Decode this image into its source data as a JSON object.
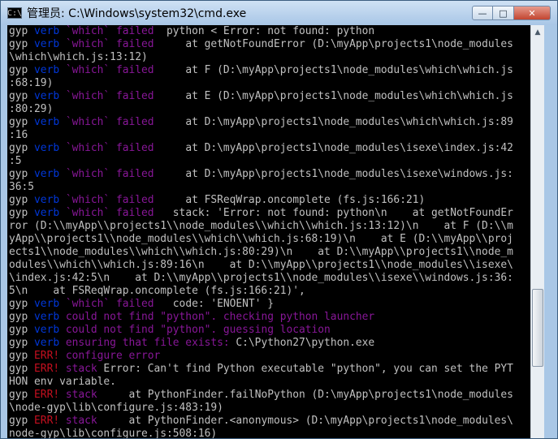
{
  "window": {
    "title": "管理员: C:\\Windows\\system32\\cmd.exe",
    "icon_glyph": "C:\\",
    "controls": {
      "minimize": "—",
      "maximize": "□",
      "close": "✕"
    }
  },
  "colors": {
    "console_bg": "#000000",
    "default": "#c0c0c0",
    "gyp": "#c0c0c0",
    "verb": "#0037da",
    "which_failed": "#881798",
    "err": "#c50f1f",
    "stack": "#881798"
  },
  "console": {
    "lines": [
      [
        {
          "t": "gyp ",
          "c": "gyp"
        },
        {
          "t": "verb",
          "c": "verb"
        },
        {
          "t": " `which` failed",
          "c": "which_failed"
        },
        {
          "t": "  python < Error: not found: python",
          "c": "default"
        }
      ],
      [
        {
          "t": "gyp ",
          "c": "gyp"
        },
        {
          "t": "verb",
          "c": "verb"
        },
        {
          "t": " `which` failed",
          "c": "which_failed"
        },
        {
          "t": "     at getNotFoundError (D:\\myApp\\projects1\\node_modules",
          "c": "default"
        }
      ],
      [
        {
          "t": "\\which\\which.js:13:12)",
          "c": "default"
        }
      ],
      [
        {
          "t": "gyp ",
          "c": "gyp"
        },
        {
          "t": "verb",
          "c": "verb"
        },
        {
          "t": " `which` failed",
          "c": "which_failed"
        },
        {
          "t": "     at F (D:\\myApp\\projects1\\node_modules\\which\\which.js",
          "c": "default"
        }
      ],
      [
        {
          "t": ":68:19)",
          "c": "default"
        }
      ],
      [
        {
          "t": "gyp ",
          "c": "gyp"
        },
        {
          "t": "verb",
          "c": "verb"
        },
        {
          "t": " `which` failed",
          "c": "which_failed"
        },
        {
          "t": "     at E (D:\\myApp\\projects1\\node_modules\\which\\which.js",
          "c": "default"
        }
      ],
      [
        {
          "t": ":80:29)",
          "c": "default"
        }
      ],
      [
        {
          "t": "gyp ",
          "c": "gyp"
        },
        {
          "t": "verb",
          "c": "verb"
        },
        {
          "t": " `which` failed",
          "c": "which_failed"
        },
        {
          "t": "     at D:\\myApp\\projects1\\node_modules\\which\\which.js:89",
          "c": "default"
        }
      ],
      [
        {
          "t": ":16",
          "c": "default"
        }
      ],
      [
        {
          "t": "gyp ",
          "c": "gyp"
        },
        {
          "t": "verb",
          "c": "verb"
        },
        {
          "t": " `which` failed",
          "c": "which_failed"
        },
        {
          "t": "     at D:\\myApp\\projects1\\node_modules\\isexe\\index.js:42",
          "c": "default"
        }
      ],
      [
        {
          "t": ":5",
          "c": "default"
        }
      ],
      [
        {
          "t": "gyp ",
          "c": "gyp"
        },
        {
          "t": "verb",
          "c": "verb"
        },
        {
          "t": " `which` failed",
          "c": "which_failed"
        },
        {
          "t": "     at D:\\myApp\\projects1\\node_modules\\isexe\\windows.js:",
          "c": "default"
        }
      ],
      [
        {
          "t": "36:5",
          "c": "default"
        }
      ],
      [
        {
          "t": "gyp ",
          "c": "gyp"
        },
        {
          "t": "verb",
          "c": "verb"
        },
        {
          "t": " `which` failed",
          "c": "which_failed"
        },
        {
          "t": "     at FSReqWrap.oncomplete (fs.js:166:21)",
          "c": "default"
        }
      ],
      [
        {
          "t": "gyp ",
          "c": "gyp"
        },
        {
          "t": "verb",
          "c": "verb"
        },
        {
          "t": " `which` failed",
          "c": "which_failed"
        },
        {
          "t": "   stack: 'Error: not found: python\\n    at getNotFoundEr",
          "c": "default"
        }
      ],
      [
        {
          "t": "ror (D:\\\\myApp\\\\projects1\\\\node_modules\\\\which\\\\which.js:13:12)\\n    at F (D:\\\\m",
          "c": "default"
        }
      ],
      [
        {
          "t": "yApp\\\\projects1\\\\node_modules\\\\which\\\\which.js:68:19)\\n    at E (D:\\\\myApp\\\\proj",
          "c": "default"
        }
      ],
      [
        {
          "t": "ects1\\\\node_modules\\\\which\\\\which.js:80:29)\\n    at D:\\\\myApp\\\\projects1\\\\node_m",
          "c": "default"
        }
      ],
      [
        {
          "t": "odules\\\\which\\\\which.js:89:16\\n    at D:\\\\myApp\\\\projects1\\\\node_modules\\\\isexe\\",
          "c": "default"
        }
      ],
      [
        {
          "t": "\\index.js:42:5\\n    at D:\\\\myApp\\\\projects1\\\\node_modules\\\\isexe\\\\windows.js:36:",
          "c": "default"
        }
      ],
      [
        {
          "t": "5\\n    at FSReqWrap.oncomplete (fs.js:166:21)',",
          "c": "default"
        }
      ],
      [
        {
          "t": "gyp ",
          "c": "gyp"
        },
        {
          "t": "verb",
          "c": "verb"
        },
        {
          "t": " `which` failed",
          "c": "which_failed"
        },
        {
          "t": "   code: 'ENOENT' }",
          "c": "default"
        }
      ],
      [
        {
          "t": "gyp ",
          "c": "gyp"
        },
        {
          "t": "verb",
          "c": "verb"
        },
        {
          "t": " could not find \"python\". checking python launcher",
          "c": "which_failed"
        }
      ],
      [
        {
          "t": "gyp ",
          "c": "gyp"
        },
        {
          "t": "verb",
          "c": "verb"
        },
        {
          "t": " could not find \"python\". guessing location",
          "c": "which_failed"
        }
      ],
      [
        {
          "t": "gyp ",
          "c": "gyp"
        },
        {
          "t": "verb",
          "c": "verb"
        },
        {
          "t": " ensuring that file exists:",
          "c": "which_failed"
        },
        {
          "t": " C:\\Python27\\python.exe",
          "c": "default"
        }
      ],
      [
        {
          "t": "gyp ",
          "c": "gyp"
        },
        {
          "t": "ERR!",
          "c": "err"
        },
        {
          "t": " configure error",
          "c": "which_failed"
        }
      ],
      [
        {
          "t": "gyp ",
          "c": "gyp"
        },
        {
          "t": "ERR!",
          "c": "err"
        },
        {
          "t": " stack",
          "c": "stack"
        },
        {
          "t": " Error: Can't find Python executable \"python\", you can set the PYT",
          "c": "default"
        }
      ],
      [
        {
          "t": "HON env variable.",
          "c": "default"
        }
      ],
      [
        {
          "t": "gyp ",
          "c": "gyp"
        },
        {
          "t": "ERR!",
          "c": "err"
        },
        {
          "t": " stack",
          "c": "stack"
        },
        {
          "t": "     at PythonFinder.failNoPython (D:\\myApp\\projects1\\node_modules",
          "c": "default"
        }
      ],
      [
        {
          "t": "\\node-gyp\\lib\\configure.js:483:19)",
          "c": "default"
        }
      ],
      [
        {
          "t": "gyp ",
          "c": "gyp"
        },
        {
          "t": "ERR!",
          "c": "err"
        },
        {
          "t": " stack",
          "c": "stack"
        },
        {
          "t": "     at PythonFinder.<anonymous> (D:\\myApp\\projects1\\node_modules\\",
          "c": "default"
        }
      ],
      [
        {
          "t": "node-gyp\\lib\\configure.js:508:16)",
          "c": "default"
        }
      ]
    ]
  }
}
